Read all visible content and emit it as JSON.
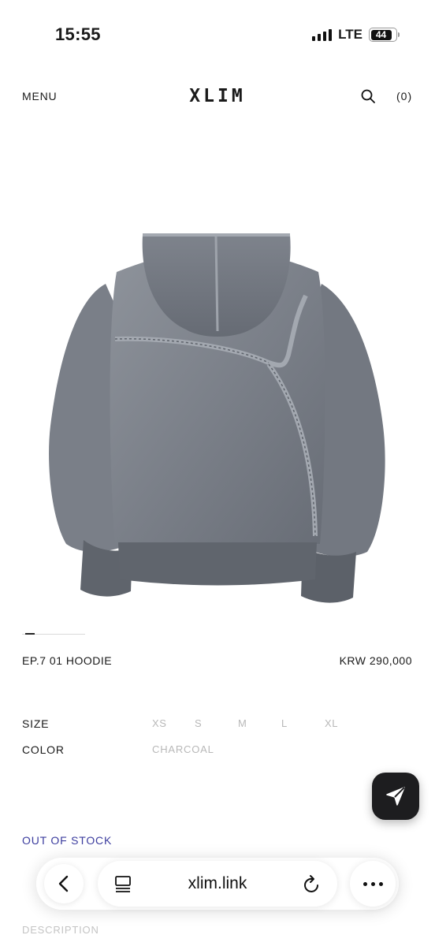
{
  "status_bar": {
    "time": "15:55",
    "network": "LTE",
    "battery": "44"
  },
  "header": {
    "menu_label": "MENU",
    "logo": "XLIM",
    "cart_label": "(0)"
  },
  "product": {
    "image_icon": "hoodie-back-photo",
    "name": "EP.7 01 HOODIE",
    "price": "KRW 290,000",
    "carousel_position": 0.15
  },
  "options": {
    "size_label": "SIZE",
    "sizes": [
      "XS",
      "S",
      "M",
      "L",
      "XL"
    ],
    "color_label": "COLOR",
    "color_value": "CHARCOAL"
  },
  "stock_status": "OUT OF STOCK",
  "description_label": "DESCRIPTION",
  "browser": {
    "url": "xlim.link"
  },
  "colors": {
    "accent_stock": "#3b3c9e",
    "disabled_text": "#b8b8b8",
    "fab_bg": "#1d1d1f"
  }
}
